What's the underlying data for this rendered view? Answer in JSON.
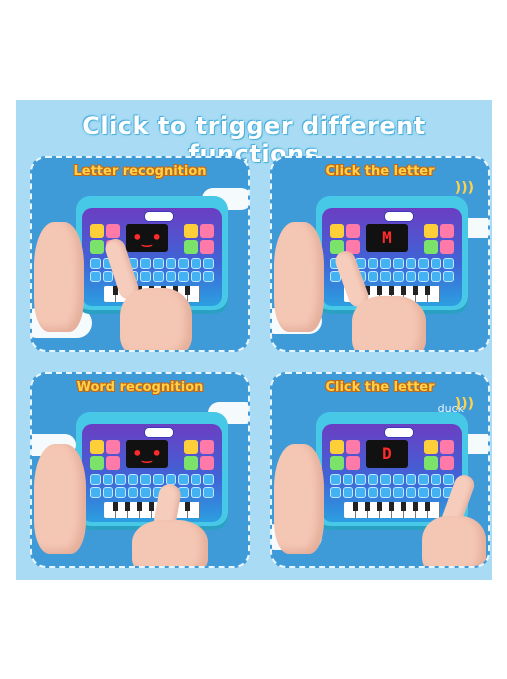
{
  "headline": "Click to trigger different functions",
  "panels": [
    {
      "title": "Letter recognition",
      "screen": "•‿•",
      "sound_word": ""
    },
    {
      "title": "Click the letter",
      "screen": "M",
      "sound_word": ""
    },
    {
      "title": "Word recognition",
      "screen": "•‿•",
      "sound_word": ""
    },
    {
      "title": "Click the letter",
      "screen": "D",
      "sound_word": "duck"
    }
  ],
  "colors": {
    "banner": "#a9dcf4",
    "panel": "#3f9ad8",
    "title_fill": "#ffd24a",
    "tablet_body": "#47c8e6",
    "screen_led": "#ff2a2a"
  }
}
